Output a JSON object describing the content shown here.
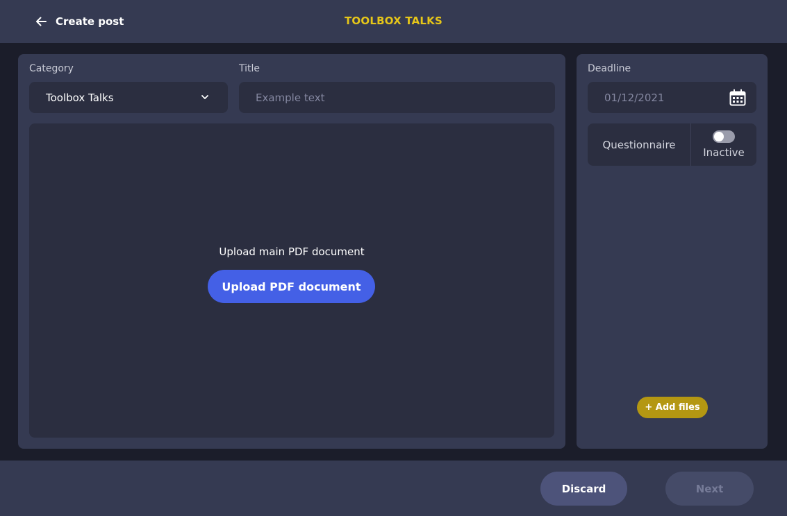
{
  "header": {
    "back_label": "Create post",
    "app_title": "TOOLBOX TALKS",
    "back_icon": "arrow-left-icon"
  },
  "form": {
    "category_label": "Category",
    "category_value": "Toolbox Talks",
    "title_label": "Title",
    "title_placeholder": "Example text",
    "title_value": ""
  },
  "upload": {
    "prompt": "Upload main PDF document",
    "button_label": "Upload PDF document"
  },
  "sidebar": {
    "deadline_label": "Deadline",
    "deadline_value": "01/12/2021",
    "calendar_icon": "calendar-icon",
    "questionnaire_label": "Questionnaire",
    "questionnaire_state": "Inactive",
    "questionnaire_enabled": false,
    "add_files_label": "+ Add files"
  },
  "footer": {
    "discard_label": "Discard",
    "next_label": "Next",
    "next_enabled": false
  },
  "colors": {
    "background": "#1b1d2a",
    "panel": "#353a52",
    "field": "#2b2e40",
    "accent_yellow": "#e6c619",
    "primary_blue": "#4460e6",
    "add_files_gold": "#b49712"
  }
}
